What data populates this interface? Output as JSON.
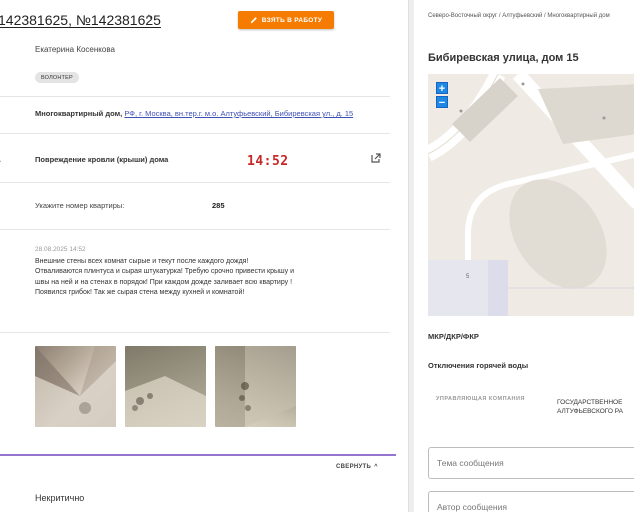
{
  "request": {
    "title": "142381625, №142381625",
    "take_button_label": "ВЗЯТЬ В РАБОТУ",
    "author_name": "Екатерина Косенкова",
    "author_role": "ВОЛОНТЕР",
    "building_type": "Многоквартирный дом,",
    "address_link": "РФ, г. Москва, вн.тер.г. м.о. Алтуфьевский, Бибиревская ул., д. 15",
    "problem": "Повреждение кровли (крыши) дома",
    "clock": "14:52",
    "apartment_label": "Укажите номер квартиры:",
    "apartment_value": "285",
    "message_date": "28.08.2025 14:52",
    "message_text": "Внешние стены всех комнат сырые и текут после каждого дождя! Отваливаются плинтуса и сырая штукатурка! Требую срочно привести крышу и швы на ней и на стенах в порядок! При каждом дожде заливает всю квартиру ! Появился грибок! Так же сырая стена между кухней и комнатой!",
    "collapse_label": "СВЕРНУТЬ",
    "severity": "Некритично"
  },
  "panel": {
    "breadcrumbs": "Северо-Восточный округ / Алтуфьевский / Многоквартирный дом",
    "place_title": "Бибиревская улица, дом 15",
    "map_building_number": "5",
    "zoom_in": "+",
    "zoom_out": "−",
    "kind": "МКР/ДКР/ФКР",
    "outage_label": "Отключения горячей воды",
    "org_label": "УПРАВЛЯЮЩАЯ КОМПАНИЯ",
    "org_value_line1": "ГОСУДАРСТВЕННОЕ",
    "org_value_line2": "АЛТУФЬЕВСКОГО РА",
    "subject_placeholder": "Тема сообщения",
    "author_placeholder": "Автор сообщения"
  },
  "icons": {
    "chevron": "chevron-up-icon",
    "pencil": "pencil-icon",
    "external": "open-in-new-icon"
  },
  "colors": {
    "accent": "#f57c00",
    "link": "#3f51b5",
    "clock": "#c62828",
    "divider_accent": "#9575cd",
    "map_zoom": "#1e88e5"
  }
}
